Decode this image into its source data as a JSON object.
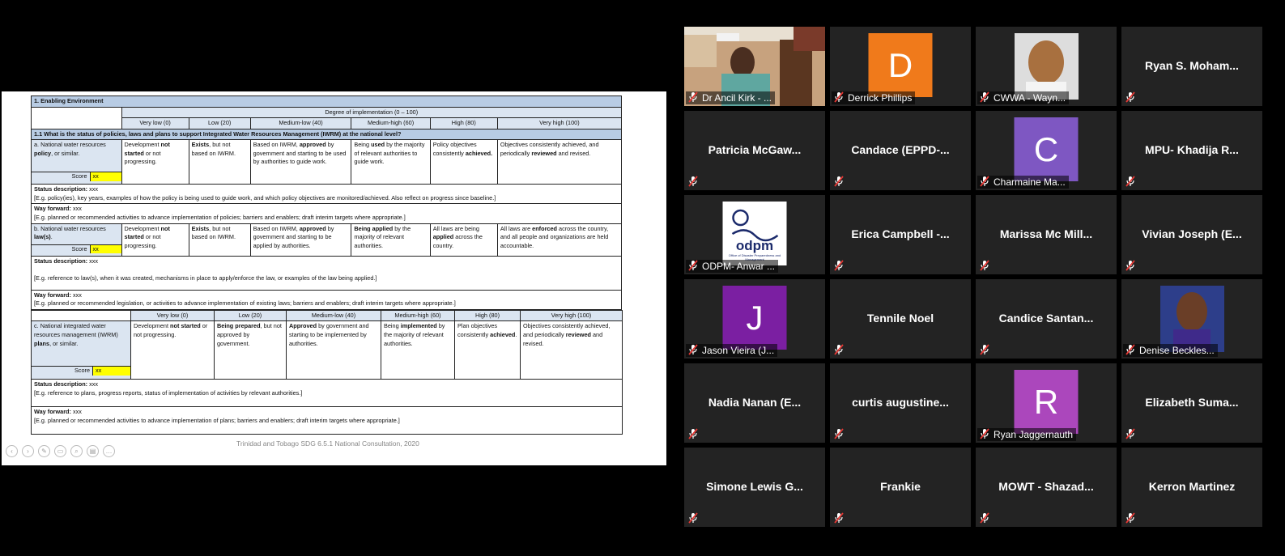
{
  "slide": {
    "sec1": "1. Enabling Environment",
    "degree_header": "Degree of implementation (0 – 100)",
    "levels": [
      "Very low (0)",
      "Low (20)",
      "Medium-low (40)",
      "Medium-high (60)",
      "High (80)",
      "Very high (100)"
    ],
    "q11": "1.1 What is the status of policies, laws and plans to support Integrated Water Resources Management (IWRM) at the national level?",
    "score_label": "Score",
    "score_value": "xx",
    "status_label": "Status description:",
    "way_label": "Way forward:",
    "xxx": "xxx",
    "a": {
      "label_pre": "a. National water resources ",
      "label_bold": "policy",
      "label_post": ", or similar.",
      "c0": [
        "Development ",
        "not started",
        " or not progressing."
      ],
      "c1": [
        "Exists",
        ", but not based on IWRM."
      ],
      "c2": [
        "Based on IWRM, ",
        "approved",
        " by government and starting to be used by authorities to guide work."
      ],
      "c3": [
        "Being ",
        "used",
        " by the majority of relevant authorities to guide work."
      ],
      "c4": [
        "Policy objectives consistently ",
        "achieved."
      ],
      "c5": [
        "Objectives consistently achieved, and periodically ",
        "reviewed",
        " and revised."
      ],
      "status_eg": "[E.g. policy(ies), key years, examples of how the policy is being used to guide work, and which policy objectives are monitored/achieved. Also reflect on progress since baseline.]",
      "way_eg": "[E.g. planned or recommended activities to advance implementation of policies; barriers and enablers; draft interim targets where appropriate.]"
    },
    "b": {
      "label_pre": "b. National water resources ",
      "label_bold": "law(s)",
      "label_post": ".",
      "c0": [
        "Development ",
        "not started",
        " or not progressing."
      ],
      "c1": [
        "Exists",
        ", but not based on IWRM."
      ],
      "c2": [
        "Based on IWRM, ",
        "approved",
        " by government and starting to be applied by authorities."
      ],
      "c3": [
        "Being applied",
        " by the majority of relevant authorities."
      ],
      "c4": [
        "All laws are being ",
        "applied",
        " across the country."
      ],
      "c5": [
        "All laws are ",
        "enforced",
        " across the country, and all people and organizations are held accountable."
      ],
      "status_eg": "[E.g. reference to law(s), when it was created, mechanisms in place to apply/enforce the law, or examples of the law being applied.]",
      "way_eg": "[E.g. planned or recommended legislation, or activities to advance implementation of existing laws; barriers and enablers; draft interim targets where appropriate.]"
    },
    "c": {
      "label_pre": "c. National integrated water resources management (IWRM) ",
      "label_bold": "plans",
      "label_post": ", or similar.",
      "c0": [
        "Development ",
        "not started",
        " or not progressing."
      ],
      "c1": [
        "Being prepared",
        ", but not approved by government."
      ],
      "c2": [
        "Approved",
        " by government and starting to be implemented by authorities."
      ],
      "c3": [
        "Being ",
        "implemented",
        " by the majority of relevant authorities."
      ],
      "c4": [
        "Plan objectives consistently ",
        "achieved",
        "."
      ],
      "c5": [
        "Objectives consistently achieved, and periodically ",
        "reviewed",
        " and revised."
      ],
      "status_eg": "[E.g. reference to plans, progress reports, status of implementation of activities by relevant authorities.]",
      "way_eg": "[E.g. planned or recommended activities to advance implementation of plans; barriers and enablers; draft interim targets where appropriate.]"
    },
    "footer": "Trinidad and Tobago SDG 6.5.1 National Consultation, 2020"
  },
  "participants": [
    {
      "display": "video",
      "caption": "Dr Ancil Kirk - ...",
      "scene": "office"
    },
    {
      "display": "avatar",
      "letter": "D",
      "color": "#f07a1b",
      "caption": "Derrick Phillips"
    },
    {
      "display": "video",
      "caption": "CWWA - Wayn...",
      "scene": "portrait"
    },
    {
      "display": "name",
      "name": "Ryan S. Moham..."
    },
    {
      "display": "name",
      "name": "Patricia McGaw..."
    },
    {
      "display": "name",
      "name": "Candace (EPPD-..."
    },
    {
      "display": "avatar",
      "letter": "C",
      "color": "#7e57c2",
      "caption": "Charmaine Ma..."
    },
    {
      "display": "name",
      "name": "MPU- Khadija R..."
    },
    {
      "display": "logo",
      "caption": "ODPM- Anwar ...",
      "logo_text": "odpm",
      "logo_sub": "Office of Disaster Preparedness and Management"
    },
    {
      "display": "name",
      "name": "Erica Campbell -..."
    },
    {
      "display": "name",
      "name": "Marissa Mc Mill..."
    },
    {
      "display": "name",
      "name": "Vivian Joseph (E..."
    },
    {
      "display": "avatar",
      "letter": "J",
      "color": "#7b1fa2",
      "caption": "Jason Vieira (J..."
    },
    {
      "display": "name",
      "name": "Tennile Noel"
    },
    {
      "display": "name",
      "name": "Candice Santan..."
    },
    {
      "display": "video",
      "caption": "Denise Beckles...",
      "scene": "woman"
    },
    {
      "display": "name",
      "name": "Nadia Nanan (E..."
    },
    {
      "display": "name",
      "name": "curtis augustine..."
    },
    {
      "display": "avatar",
      "letter": "R",
      "color": "#ab47bc",
      "caption": "Ryan Jaggernauth"
    },
    {
      "display": "name",
      "name": "Elizabeth Suma..."
    },
    {
      "display": "name",
      "name": "Simone Lewis G..."
    },
    {
      "display": "name",
      "name": "Frankie"
    },
    {
      "display": "name",
      "name": "MOWT - Shazad..."
    },
    {
      "display": "name",
      "name": "Kerron Martinez"
    }
  ],
  "icons": {
    "mic": "muted-microphone-icon"
  },
  "colors": {
    "tile_bg": "#232323",
    "section_blue": "#b8cce4",
    "header_blue": "#dbe5f1",
    "score_yellow": "#ffff00",
    "mute_red": "#e53935"
  }
}
